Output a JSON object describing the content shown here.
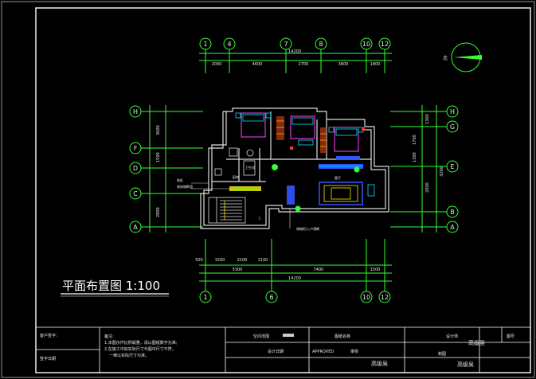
{
  "drawing": {
    "title": "平面布置图 1:100",
    "north_label": "北"
  },
  "grid_top": [
    "1",
    "4",
    "7",
    "8",
    "10",
    "12"
  ],
  "grid_bottom": [
    "1",
    "6",
    "10",
    "12"
  ],
  "grid_left": [
    "H",
    "F",
    "D",
    "C",
    "A"
  ],
  "grid_right": [
    "H",
    "G",
    "E",
    "B",
    "A"
  ],
  "dims_top": {
    "total": "14200",
    "segments": [
      "2000",
      "4600",
      "2700",
      "3600",
      "1800"
    ]
  },
  "dims_bottom": {
    "row1": [
      "500",
      "1500",
      "2100",
      "1100"
    ],
    "row2": [
      "5300",
      "7400",
      "1500"
    ],
    "total": "14200"
  },
  "dims_left": [
    "3600",
    "1500",
    "2800"
  ],
  "dims_right": [
    "1300",
    "1700",
    "1300",
    "2000",
    "3200"
  ],
  "room_labels": {
    "bath": "卫生间",
    "kitchen": "厨房",
    "stair_up": "上",
    "living": "客厅",
    "note": "储物柜/入户隔断",
    "leader1": "鞋柜",
    "leader2": "装饰隔断墙"
  },
  "title_block": {
    "client": "客户签字:",
    "notes_label": "备注:",
    "note1": "1.本图示作比例或量，请以图纸数字为准;",
    "note2": "2.在施工中如实际尺寸与图中尺寸不符，",
    "note3": "一律以实际尺寸为准。",
    "date": "签字日期",
    "project": "空间范围",
    "drawing_name": "图纸名称",
    "design": "设计日期",
    "approved": "APPROVED",
    "audit": "审核",
    "designer": "设计师",
    "company": "高级吴",
    "drawn": "制图",
    "drawn_by": "高级吴",
    "page": "图号",
    "stamp": "高级吴"
  },
  "colors": {
    "frame": "#ffffff",
    "grid": "#33ff33",
    "wall": "#dddddd",
    "cyan": "#00e5ff",
    "magenta": "#ff44ff",
    "yellow": "#ffe600",
    "blue": "#3355ff",
    "red": "#ff3333"
  }
}
